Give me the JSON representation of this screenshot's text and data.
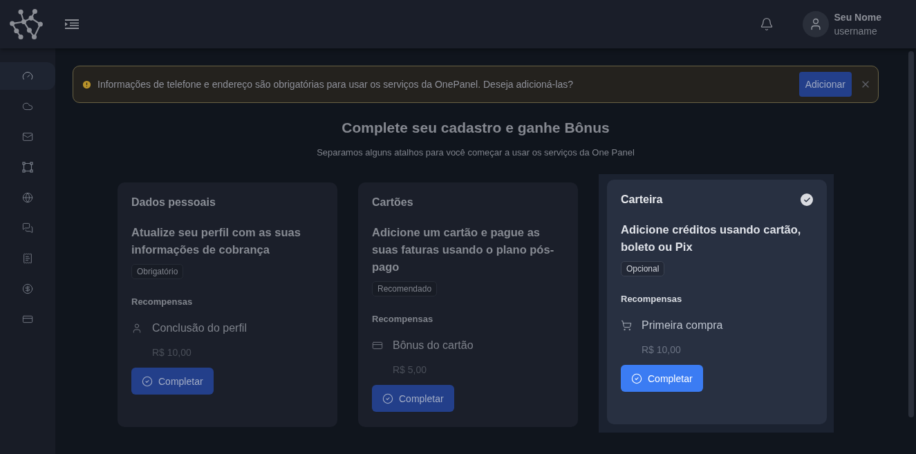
{
  "header": {
    "user_name": "Seu Nome",
    "user_handle": "username"
  },
  "sidebar": {
    "items": [
      {
        "kind": "dashboard",
        "selected": true
      },
      {
        "kind": "cloud",
        "selected": false
      },
      {
        "kind": "mail",
        "selected": false
      },
      {
        "kind": "frame",
        "selected": false
      },
      {
        "kind": "globe",
        "selected": false
      },
      {
        "kind": "chat",
        "selected": false
      },
      {
        "kind": "receipt",
        "selected": false
      },
      {
        "kind": "dollar",
        "selected": false
      },
      {
        "kind": "card",
        "selected": false
      }
    ]
  },
  "alert": {
    "message": "Informações de telefone e endereço são obrigatórias para usar os serviços da OnePanel. Deseja adicioná-las?",
    "action": "Adicionar"
  },
  "intro": {
    "title": "Complete seu cadastro e ganhe Bônus",
    "subtitle": "Separamos alguns atalhos para você começar a usar os serviços da One Panel"
  },
  "cards": [
    {
      "title": "Dados pessoais",
      "description": "Atualize seu perfil com as suas informações de cobrança",
      "tag": "Obrigatório",
      "rewards_label": "Recompensas",
      "reward": {
        "kind": "profile",
        "name": "Conclusão do perfil",
        "amount": "R$ 10,00"
      },
      "button": "Completar",
      "highlighted": false,
      "done": false
    },
    {
      "title": "Cartões",
      "description": "Adicione um cartão e pague as suas faturas usando o plano pós-pago",
      "tag": "Recomendado",
      "rewards_label": "Recompensas",
      "reward": {
        "kind": "card",
        "name": "Bônus do cartão",
        "amount": "R$ 5,00"
      },
      "button": "Completar",
      "highlighted": false,
      "done": false
    },
    {
      "title": "Carteira",
      "description": "Adicione créditos usando cartão, boleto ou Pix",
      "tag": "Opcional",
      "rewards_label": "Recompensas",
      "reward": {
        "kind": "purchase",
        "name": "Primeira compra",
        "amount": "R$ 10,00"
      },
      "button": "Completar",
      "highlighted": true,
      "done": true
    }
  ]
}
